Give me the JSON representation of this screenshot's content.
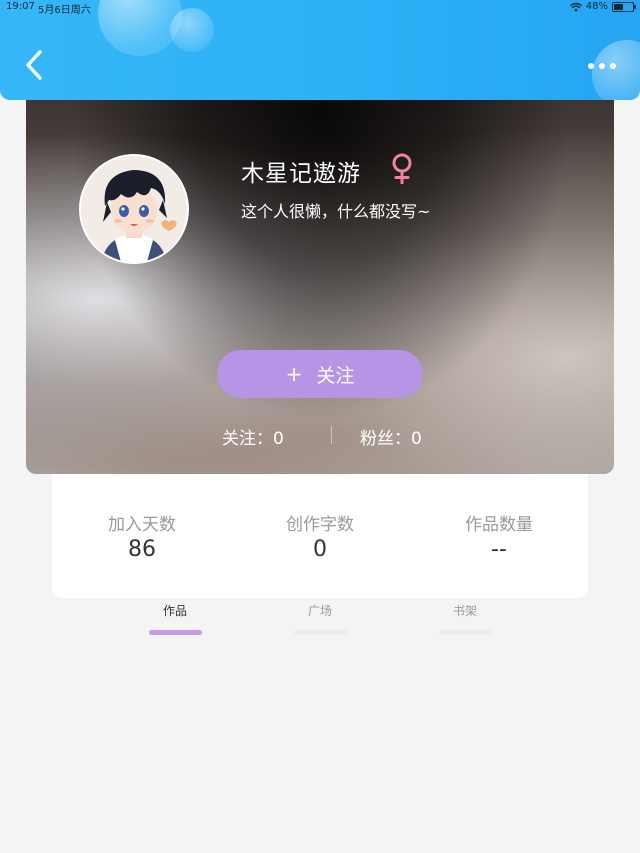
{
  "status_bar": {
    "time": "19:07",
    "date": "5月6日周六",
    "battery": "48%",
    "battery_level": 0.48
  },
  "header": {
    "back_icon": "chevron-left-icon",
    "more_icon": "more-horizontal-icon",
    "accent_color": "#2fb3f7"
  },
  "profile": {
    "username": "木星记遨游",
    "gender_icon": "female-symbol-icon",
    "gender_color": "#f0839f",
    "bio": "这个人很懒，什么都没写~",
    "follow_button": {
      "plus": "+",
      "label": "关注",
      "color": "#b794e6"
    },
    "following": "关注：0",
    "followers": "粉丝：0"
  },
  "stats": [
    {
      "label": "加入天数",
      "value": "86"
    },
    {
      "label": "创作字数",
      "value": "0"
    },
    {
      "label": "作品数量",
      "value": "--"
    }
  ],
  "tabs": [
    {
      "label": "作品",
      "active": true
    },
    {
      "label": "广场",
      "active": false
    },
    {
      "label": "书架",
      "active": false
    }
  ]
}
